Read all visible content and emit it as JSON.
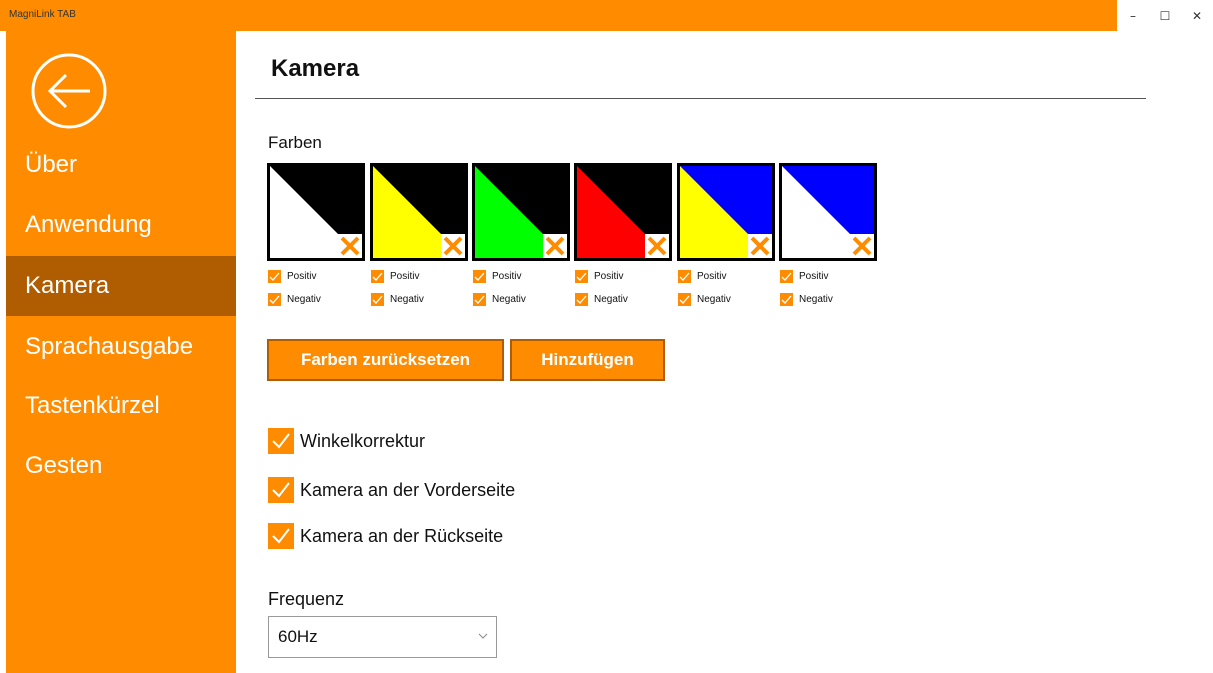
{
  "window": {
    "title": "MagniLink TAB",
    "controls": {
      "minimize": "–",
      "maximize": "☐",
      "close": "✕"
    }
  },
  "sidebar": {
    "back_icon": "back-arrow-circle-icon",
    "items": [
      {
        "label": "Über",
        "active": false
      },
      {
        "label": "Anwendung",
        "active": false
      },
      {
        "label": "Kamera",
        "active": true
      },
      {
        "label": "Sprachausgabe",
        "active": false
      },
      {
        "label": "Tastenkürzel",
        "active": false
      },
      {
        "label": "Gesten",
        "active": false
      }
    ]
  },
  "main": {
    "title": "Kamera",
    "colors_label": "Farben",
    "swatches": [
      {
        "foreground": "#ffffff",
        "background": "#000000",
        "positive_label": "Positiv",
        "positive_checked": true,
        "negative_label": "Negativ",
        "negative_checked": true
      },
      {
        "foreground": "#ffff00",
        "background": "#000000",
        "positive_label": "Positiv",
        "positive_checked": true,
        "negative_label": "Negativ",
        "negative_checked": true
      },
      {
        "foreground": "#00ff00",
        "background": "#000000",
        "positive_label": "Positiv",
        "positive_checked": true,
        "negative_label": "Negativ",
        "negative_checked": true
      },
      {
        "foreground": "#ff0000",
        "background": "#000000",
        "positive_label": "Positiv",
        "positive_checked": true,
        "negative_label": "Negativ",
        "negative_checked": true
      },
      {
        "foreground": "#ffff00",
        "background": "#0000ff",
        "positive_label": "Positiv",
        "positive_checked": true,
        "negative_label": "Negativ",
        "negative_checked": true
      },
      {
        "foreground": "#ffffff",
        "background": "#0000ff",
        "positive_label": "Positiv",
        "positive_checked": true,
        "negative_label": "Negativ",
        "negative_checked": true
      }
    ],
    "reset_button": "Farben zurücksetzen",
    "add_button": "Hinzufügen",
    "options": [
      {
        "label": "Winkelkorrektur",
        "checked": true
      },
      {
        "label": "Kamera an der Vorderseite",
        "checked": true
      },
      {
        "label": "Kamera an der Rückseite",
        "checked": true
      }
    ],
    "frequency": {
      "label": "Frequenz",
      "value": "60Hz"
    }
  },
  "colors": {
    "accent": "#ff8c00",
    "accent_dark": "#b05c00"
  }
}
